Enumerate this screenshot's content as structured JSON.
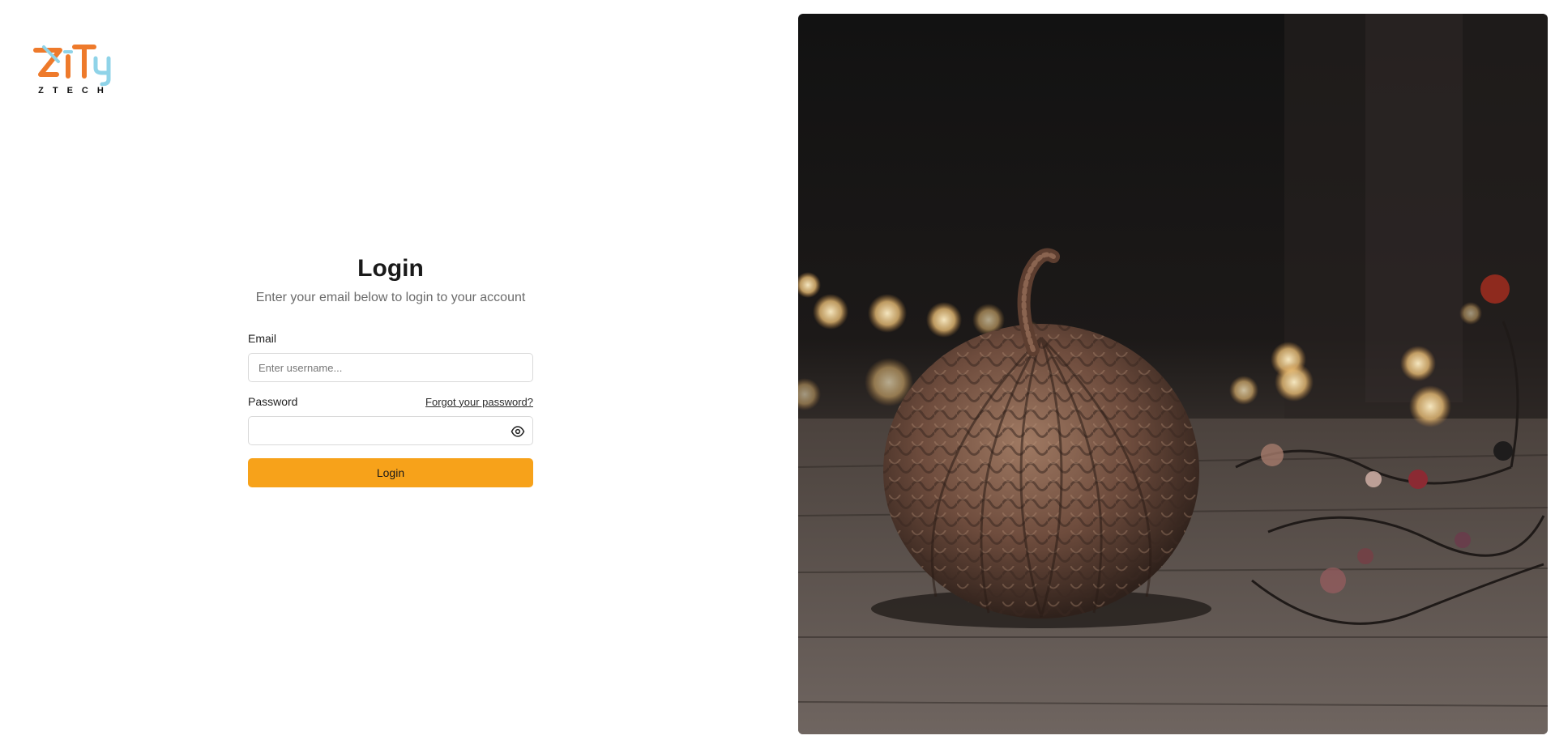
{
  "brand": {
    "logo_letters": "ZiTy",
    "tagline": "ZTECH",
    "colors": {
      "orange": "#ee7a2b",
      "light_blue": "#8fd3e8"
    }
  },
  "login": {
    "title": "Login",
    "subtitle": "Enter your email below to login to your account",
    "email_label": "Email",
    "email_placeholder": "Enter username...",
    "email_value": "",
    "password_label": "Password",
    "password_value": "",
    "forgot_link": "Forgot your password?",
    "password_toggle_icon": "eye-icon",
    "submit_label": "Login",
    "accent_color": "#f7a21a"
  },
  "hero_image": {
    "subject": "woven-pumpkin-with-bokeh-lights"
  }
}
